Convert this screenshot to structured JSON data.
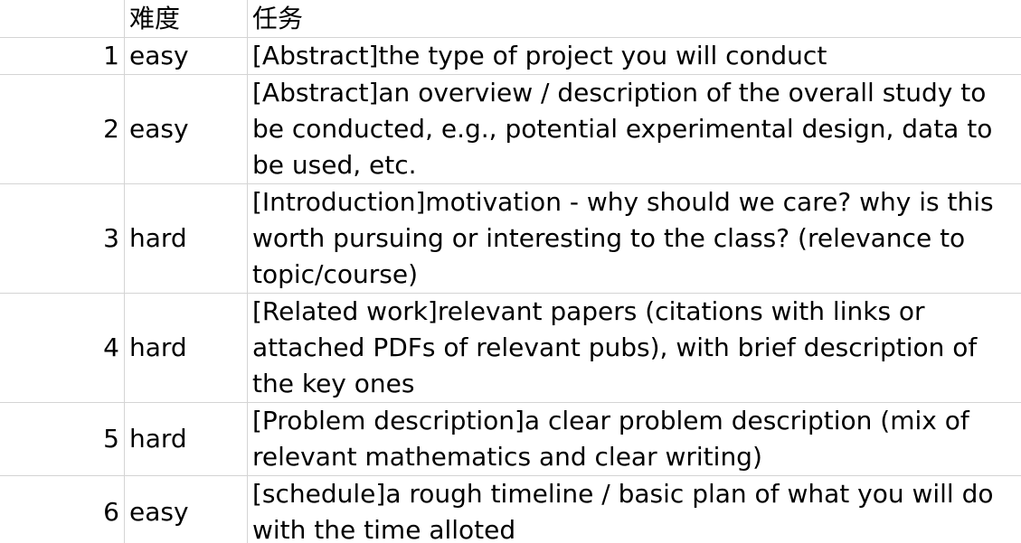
{
  "header": {
    "index": "",
    "difficulty": "难度",
    "task": "任务"
  },
  "rows": [
    {
      "index": "1",
      "difficulty": "easy",
      "task": "[Abstract]the type of project you will conduct"
    },
    {
      "index": "2",
      "difficulty": "easy",
      "task": "[Abstract]an overview / description of the overall study to be conducted, e.g., potential experimental design, data to be used, etc."
    },
    {
      "index": "3",
      "difficulty": "hard",
      "task": "[Introduction]motivation - why should we care? why is this worth pursuing or interesting to the class? (relevance to topic/course)"
    },
    {
      "index": "4",
      "difficulty": "hard",
      "task": "[Related work]relevant papers (citations with links or attached PDFs of relevant pubs), with brief description of the key ones"
    },
    {
      "index": "5",
      "difficulty": "hard",
      "task": "[Problem description]a clear problem description (mix of relevant mathematics and clear writing)"
    },
    {
      "index": "6",
      "difficulty": "easy",
      "task": "[schedule]a rough timeline / basic plan of what you will do with the time alloted"
    }
  ]
}
